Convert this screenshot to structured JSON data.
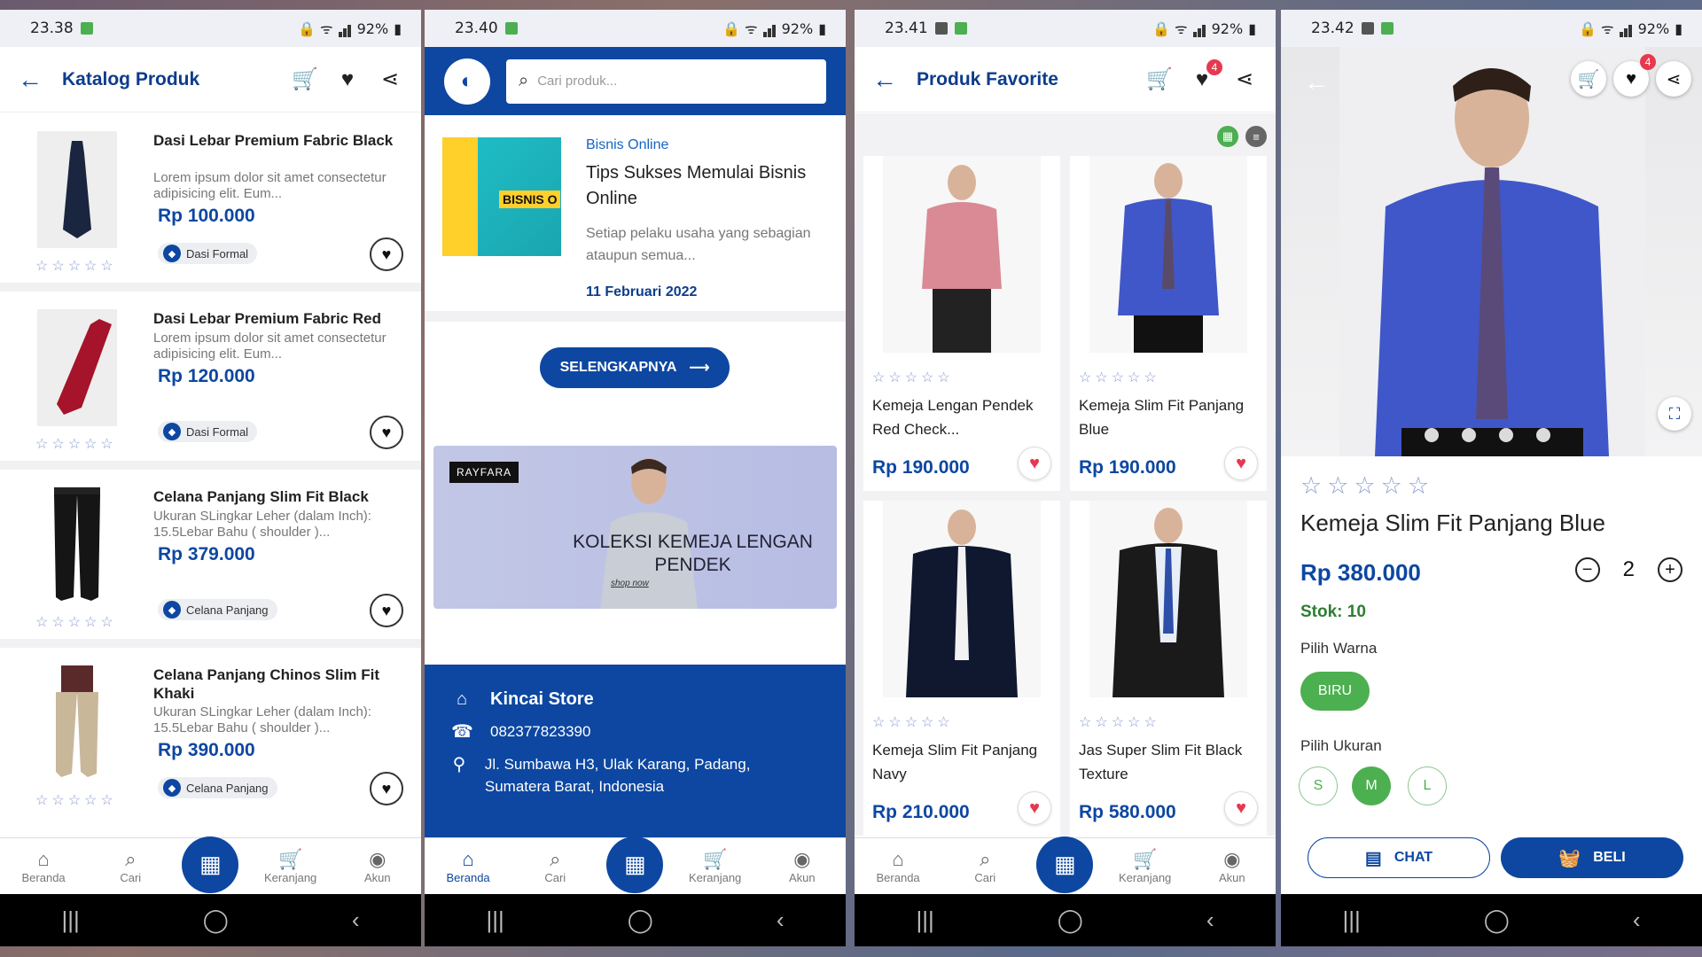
{
  "status": [
    {
      "time": "23.38",
      "battery": "92%"
    },
    {
      "time": "23.40",
      "battery": "92%"
    },
    {
      "time": "23.41",
      "battery": "92%"
    },
    {
      "time": "23.42",
      "battery": "92%"
    }
  ],
  "catalog": {
    "title": "Katalog Produk",
    "items": [
      {
        "name": "Dasi Lebar Premium Fabric Black",
        "desc": "Lorem ipsum dolor sit amet consectetur adipisicing elit. Eum...",
        "price": "Rp 100.000",
        "category": "Dasi Formal",
        "stars": "☆☆☆☆☆"
      },
      {
        "name": "Dasi Lebar Premium Fabric Red",
        "desc": "Lorem ipsum dolor sit amet consectetur adipisicing elit. Eum...",
        "price": "Rp 120.000",
        "category": "Dasi Formal",
        "stars": "☆☆☆☆☆"
      },
      {
        "name": "Celana Panjang Slim Fit Black",
        "desc": "Ukuran SLingkar Leher (dalam Inch): 15.5Lebar Bahu ( shoulder )...",
        "price": "Rp 379.000",
        "category": "Celana Panjang",
        "stars": "☆☆☆☆☆"
      },
      {
        "name": "Celana Panjang Chinos Slim Fit Khaki",
        "desc": "Ukuran SLingkar Leher (dalam Inch): 15.5Lebar Bahu ( shoulder )...",
        "price": "Rp 390.000",
        "category": "Celana Panjang",
        "stars": "☆☆☆☆☆"
      }
    ]
  },
  "home": {
    "search_placeholder": "Cari produk...",
    "article": {
      "category": "Bisnis Online",
      "title": "Tips Sukses Memulai Bisnis Online",
      "summary": "Setiap pelaku usaha yang sebagian ataupun semua...",
      "date": "11 Februari 2022",
      "image_text": "BISNIS O"
    },
    "more_label": "SELENGKAPNYA",
    "banner": {
      "brand": "RAYFARA",
      "text": "KOLEKSI KEMEJA LENGAN PENDEK",
      "shop": "shop now"
    },
    "store": {
      "name": "Kincai Store",
      "phone": "082377823390",
      "address": "Jl. Sumbawa H3, Ulak Karang, Padang, Sumatera Barat, Indonesia"
    }
  },
  "favorite": {
    "title": "Produk Favorite",
    "badge": "4",
    "items": [
      {
        "name": "Kemeja Lengan Pendek Red Check...",
        "price": "Rp 190.000",
        "stars": "☆☆☆☆☆"
      },
      {
        "name": "Kemeja Slim Fit Panjang Blue",
        "price": "Rp 190.000",
        "stars": "☆☆☆☆☆"
      },
      {
        "name": "Kemeja Slim Fit Panjang Navy",
        "price": "Rp 210.000",
        "stars": "☆☆☆☆☆"
      },
      {
        "name": "Jas Super Slim Fit Black Texture",
        "price": "Rp 580.000",
        "stars": "☆☆☆☆☆"
      }
    ]
  },
  "detail": {
    "badge": "4",
    "stars": "☆☆☆☆☆",
    "name": "Kemeja Slim Fit Panjang Blue",
    "price": "Rp 380.000",
    "qty": "2",
    "stock": "Stok: 10",
    "color_label": "Pilih Warna",
    "color": "BIRU",
    "size_label": "Pilih Ukuran",
    "sizes": [
      "S",
      "M",
      "L"
    ],
    "chat": "CHAT",
    "buy": "BELI"
  },
  "nav": {
    "home": "Beranda",
    "search": "Cari",
    "cart": "Keranjang",
    "account": "Akun"
  },
  "colors": {
    "primary": "#0d47a1",
    "accent": "#e53950",
    "success": "#4caf50"
  }
}
